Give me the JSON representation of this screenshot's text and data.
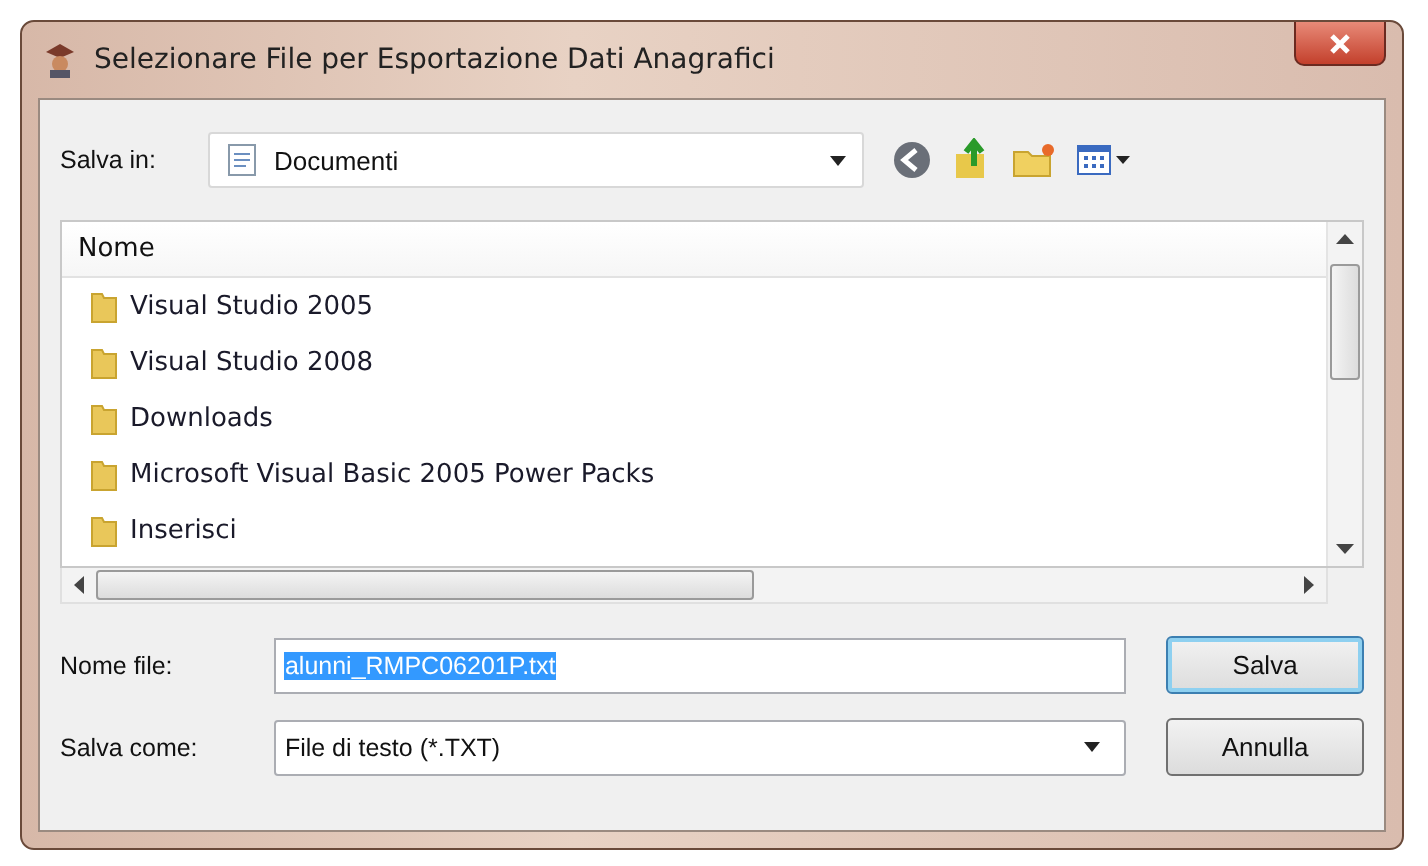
{
  "window": {
    "title": "Selezionare File per Esportazione Dati Anagrafici"
  },
  "location": {
    "label": "Salva in:",
    "value": "Documenti"
  },
  "list": {
    "column": "Nome",
    "items": [
      {
        "name": "Visual Studio 2005"
      },
      {
        "name": "Visual Studio 2008"
      },
      {
        "name": "Downloads"
      },
      {
        "name": "Microsoft Visual Basic 2005 Power Packs"
      },
      {
        "name": "Inserisci"
      }
    ]
  },
  "file_name": {
    "label": "Nome file:",
    "value": "alunni_RMPC06201P.txt"
  },
  "file_type": {
    "label": "Salva come:",
    "value": "File di testo (*.TXT)"
  },
  "buttons": [
    {
      "label": "Salva",
      "kind": "default"
    },
    {
      "label": "Annulla",
      "kind": "normal"
    }
  ]
}
